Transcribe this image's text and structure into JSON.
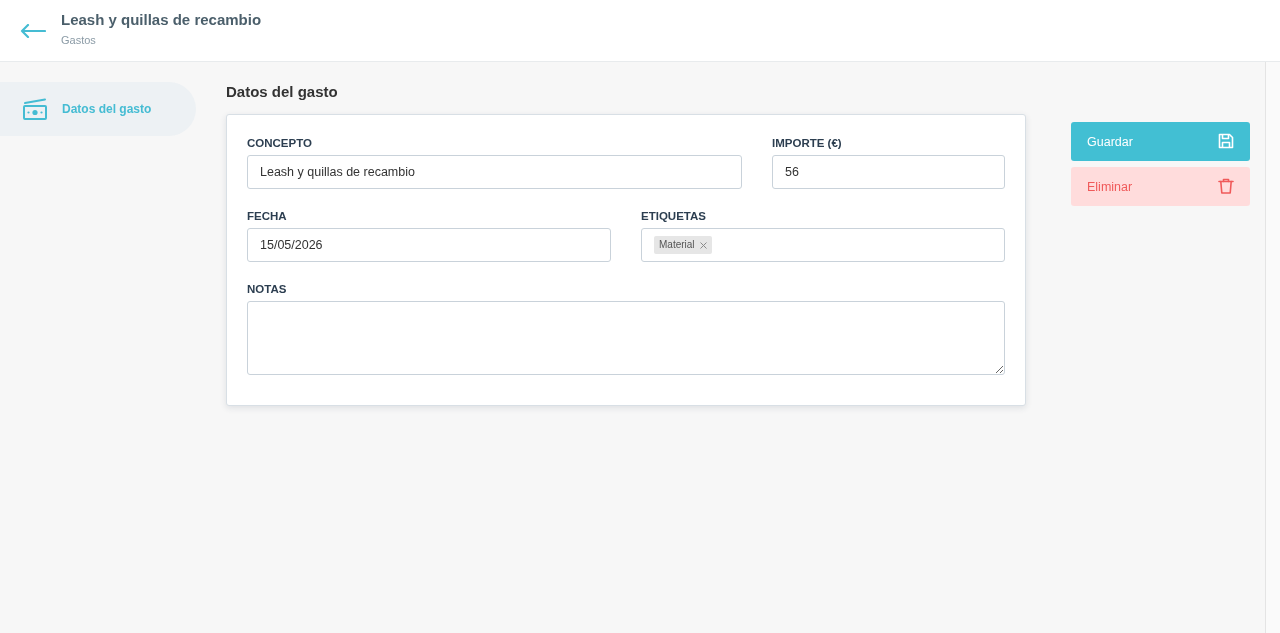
{
  "header": {
    "title": "Leash y quillas de recambio",
    "subtitle": "Gastos"
  },
  "sidebar": {
    "items": [
      {
        "label": "Datos del gasto",
        "selected": true
      }
    ]
  },
  "section": {
    "title": "Datos del gasto"
  },
  "form": {
    "rows": [
      {
        "fields": [
          {
            "kind": "text",
            "label": "CONCEPTO",
            "value": "Leash y quillas de recambio"
          },
          {
            "kind": "text",
            "label": "IMPORTE (€)",
            "value": "56"
          }
        ]
      },
      {
        "fields": [
          {
            "kind": "text",
            "label": "FECHA",
            "value": "15/05/2026"
          },
          {
            "kind": "tags",
            "label": "ETIQUETAS",
            "tags": [
              "Material"
            ]
          }
        ]
      },
      {
        "fields": [
          {
            "kind": "textarea",
            "label": "NOTAS"
          }
        ]
      }
    ]
  },
  "actions": [
    {
      "kind": "save",
      "label": "Guardar"
    },
    {
      "kind": "delete",
      "label": "Eliminar"
    }
  ]
}
